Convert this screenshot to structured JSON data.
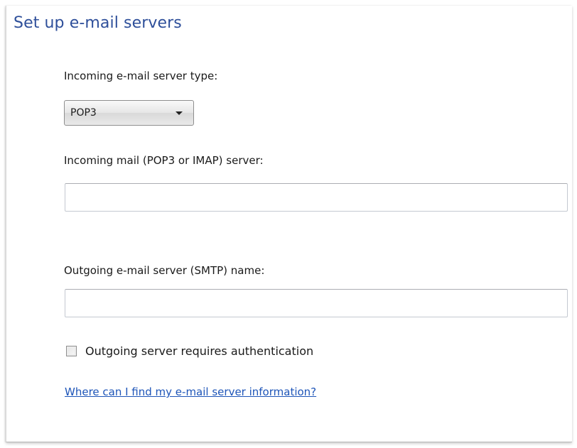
{
  "page": {
    "title": "Set up e-mail servers"
  },
  "incoming_type": {
    "label": "Incoming e-mail server type:",
    "selected": "POP3",
    "icon": "chevron-down-icon"
  },
  "incoming_server": {
    "label": "Incoming mail (POP3 or IMAP) server:",
    "value": ""
  },
  "outgoing_server": {
    "label": "Outgoing e-mail server (SMTP) name:",
    "value": ""
  },
  "auth_checkbox": {
    "label": "Outgoing server requires authentication",
    "checked": false
  },
  "help_link": {
    "text": "Where can I find my e-mail server information?"
  },
  "colors": {
    "title": "#2e4f9a",
    "link": "#1e55b8"
  }
}
